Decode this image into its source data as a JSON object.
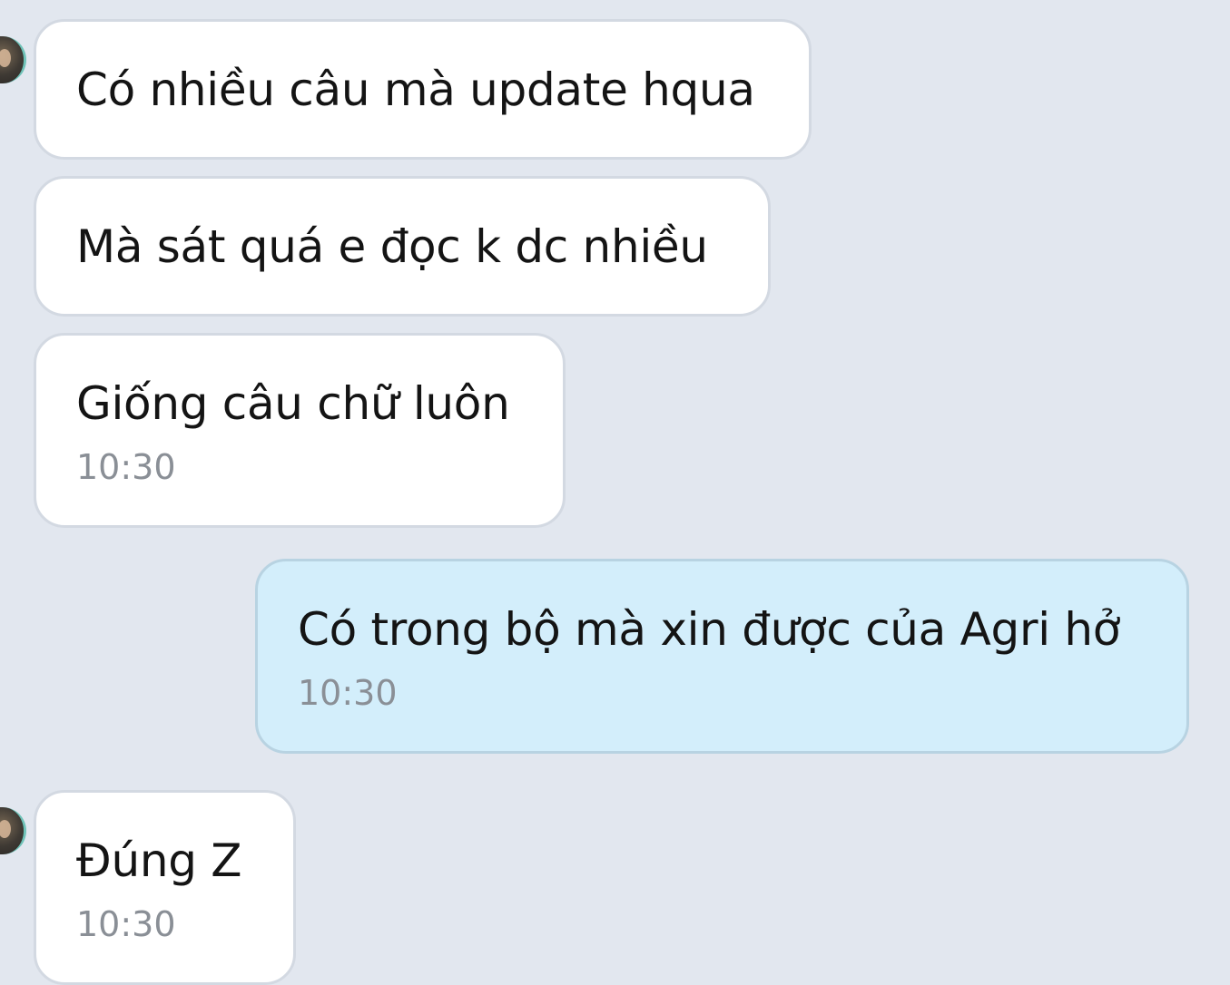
{
  "messages": [
    {
      "direction": "incoming",
      "text": "Có nhiều câu mà update hqua",
      "time": ""
    },
    {
      "direction": "incoming",
      "text": "Mà sát quá e đọc k dc nhiều",
      "time": ""
    },
    {
      "direction": "incoming",
      "text": "Giống câu chữ luôn",
      "time": "10:30"
    },
    {
      "direction": "outgoing",
      "text": "Có trong bộ mà xin được của Agri hở",
      "time": "10:30"
    },
    {
      "direction": "incoming",
      "text": "Đúng Z",
      "time": "10:30"
    }
  ],
  "colors": {
    "background": "#e2e7ef",
    "incoming_bubble": "#ffffff",
    "outgoing_bubble": "#d3eefb",
    "time_text": "#8a8f96"
  },
  "icons": [
    "sender-avatar"
  ]
}
